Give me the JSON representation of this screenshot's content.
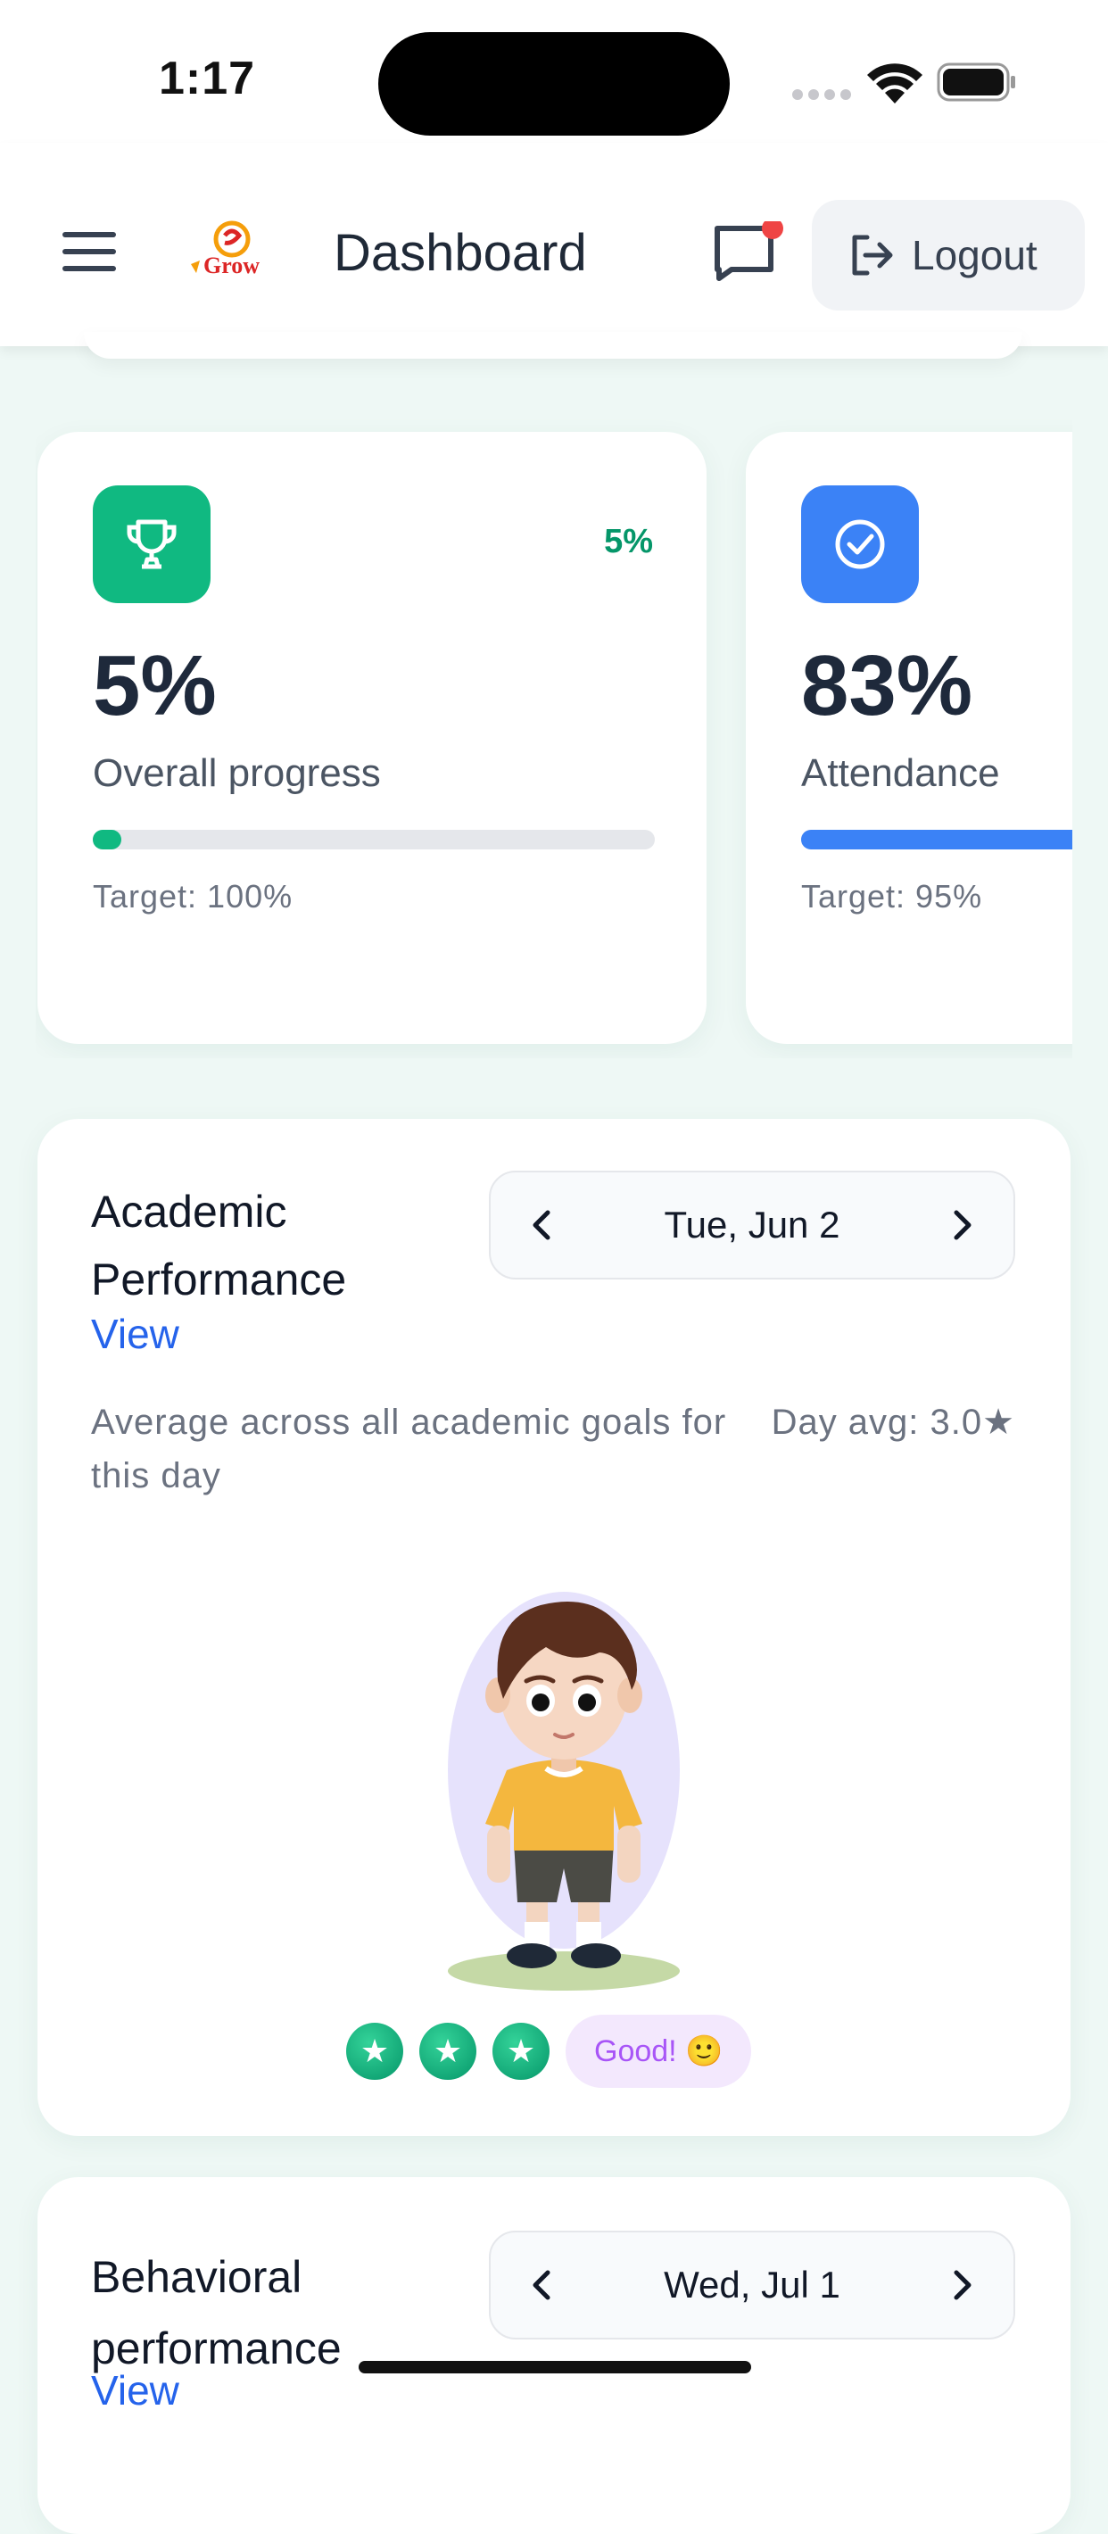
{
  "status_bar": {
    "time": "1:17"
  },
  "header": {
    "title": "Dashboard",
    "logo_text": "Grow",
    "logout_label": "Logout"
  },
  "stats": [
    {
      "icon": "trophy-icon",
      "value": "5%",
      "badge": "5%",
      "label": "Overall progress",
      "progress": 0.05,
      "target": "Target: 100%",
      "color": "#10b981"
    },
    {
      "icon": "check-circle-icon",
      "value": "83%",
      "label": "Attendance",
      "progress": 0.83,
      "target": "Target: 95%",
      "color": "#3b82f6"
    }
  ],
  "academic": {
    "title_line1": "Academic",
    "title_line2": "Performance",
    "view": "View",
    "date": "Tue, Jun 2",
    "description": "Average across all academic goals for this day",
    "day_avg": "Day avg: 3.0★",
    "stars": 3,
    "mood": "Good! 🙂"
  },
  "behavioral": {
    "title_line1": "Behavioral",
    "title_line2": "performance",
    "view": "View",
    "date": "Wed, Jul 1"
  }
}
